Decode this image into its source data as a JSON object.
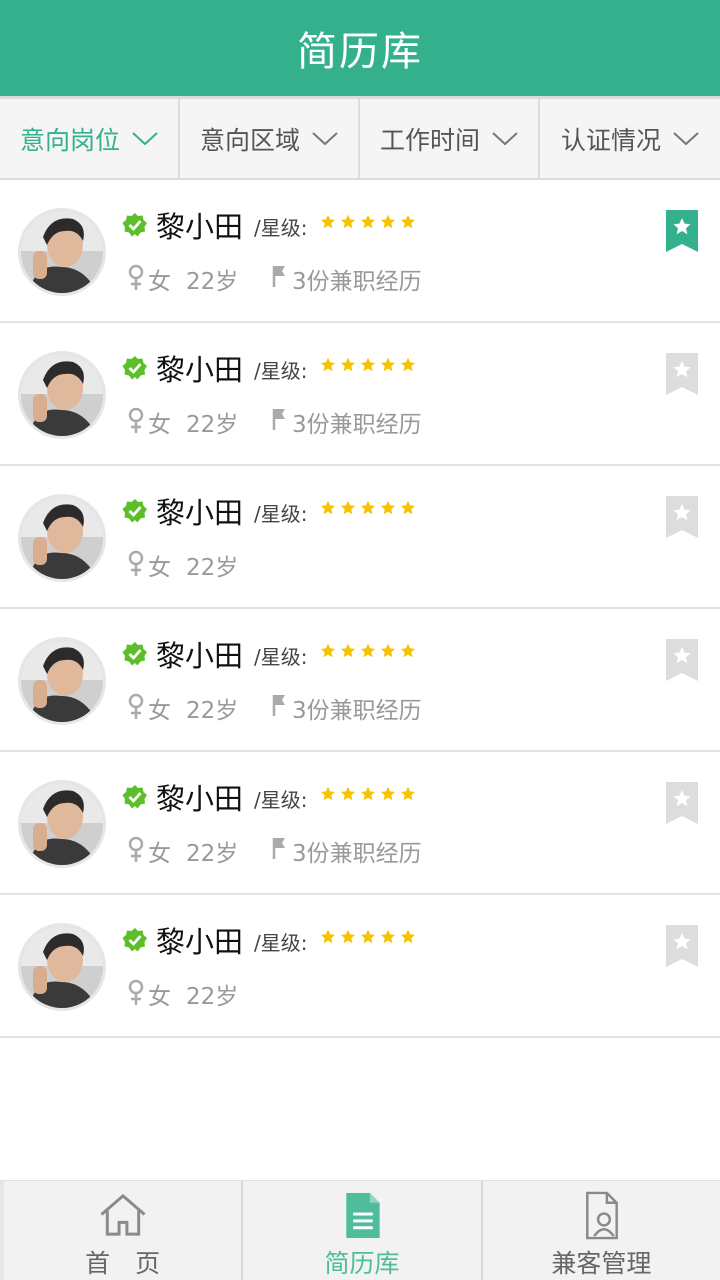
{
  "header": {
    "title": "简历库"
  },
  "filters": [
    {
      "label": "意向岗位",
      "active": true
    },
    {
      "label": "意向区域",
      "active": false
    },
    {
      "label": "工作时间",
      "active": false
    },
    {
      "label": "认证情况",
      "active": false
    }
  ],
  "items": [
    {
      "name": "黎小田",
      "star_label": "/星级:",
      "stars": 5,
      "gender": "女",
      "age": "22岁",
      "experience": "3份兼职经历",
      "bookmarked": true
    },
    {
      "name": "黎小田",
      "star_label": "/星级:",
      "stars": 5,
      "gender": "女",
      "age": "22岁",
      "experience": "3份兼职经历",
      "bookmarked": false
    },
    {
      "name": "黎小田",
      "star_label": "/星级:",
      "stars": 5,
      "gender": "女",
      "age": "22岁",
      "experience": "",
      "bookmarked": false
    },
    {
      "name": "黎小田",
      "star_label": "/星级:",
      "stars": 5,
      "gender": "女",
      "age": "22岁",
      "experience": "3份兼职经历",
      "bookmarked": false
    },
    {
      "name": "黎小田",
      "star_label": "/星级:",
      "stars": 5,
      "gender": "女",
      "age": "22岁",
      "experience": "3份兼职经历",
      "bookmarked": false
    },
    {
      "name": "黎小田",
      "star_label": "/星级:",
      "stars": 5,
      "gender": "女",
      "age": "22岁",
      "experience": "",
      "bookmarked": false
    }
  ],
  "tabbar": [
    {
      "label": "首　页",
      "icon": "home-icon",
      "active": false
    },
    {
      "label": "简历库",
      "icon": "document-icon",
      "active": true
    },
    {
      "label": "兼客管理",
      "icon": "person-file-icon",
      "active": false
    }
  ],
  "colors": {
    "accent": "#34b08c",
    "star": "#f7c300",
    "verified": "#5cbf2a",
    "bookmark_off": "#dddddd"
  }
}
